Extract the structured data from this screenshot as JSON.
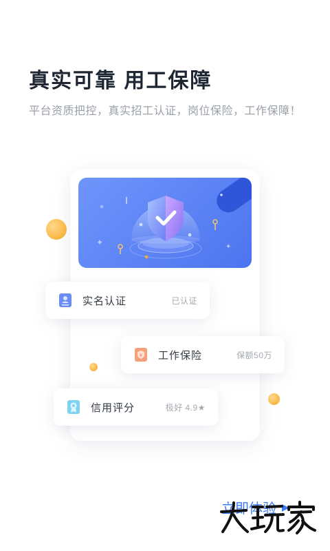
{
  "header": {
    "title": "真实可靠 用工保障",
    "subtitle": "平台资质把控，真实招工认证，岗位保险，工作保障！"
  },
  "banner": {
    "icon": "shield-check-icon"
  },
  "cards": [
    {
      "label": "实名认证",
      "value": "已认证",
      "icon": "id-card-icon"
    },
    {
      "label": "工作保险",
      "value": "保额50万",
      "icon": "insurance-icon"
    },
    {
      "label": "信用评分",
      "value": "极好 4.9★",
      "icon": "credit-badge-icon"
    }
  ],
  "cta": {
    "label": "立即体验",
    "arrow": "▶"
  },
  "watermark": {
    "text": "大玩家"
  },
  "colors": {
    "accent": "#3c7cf0",
    "banner": "#5b82f5",
    "ball": "#f5a623"
  }
}
